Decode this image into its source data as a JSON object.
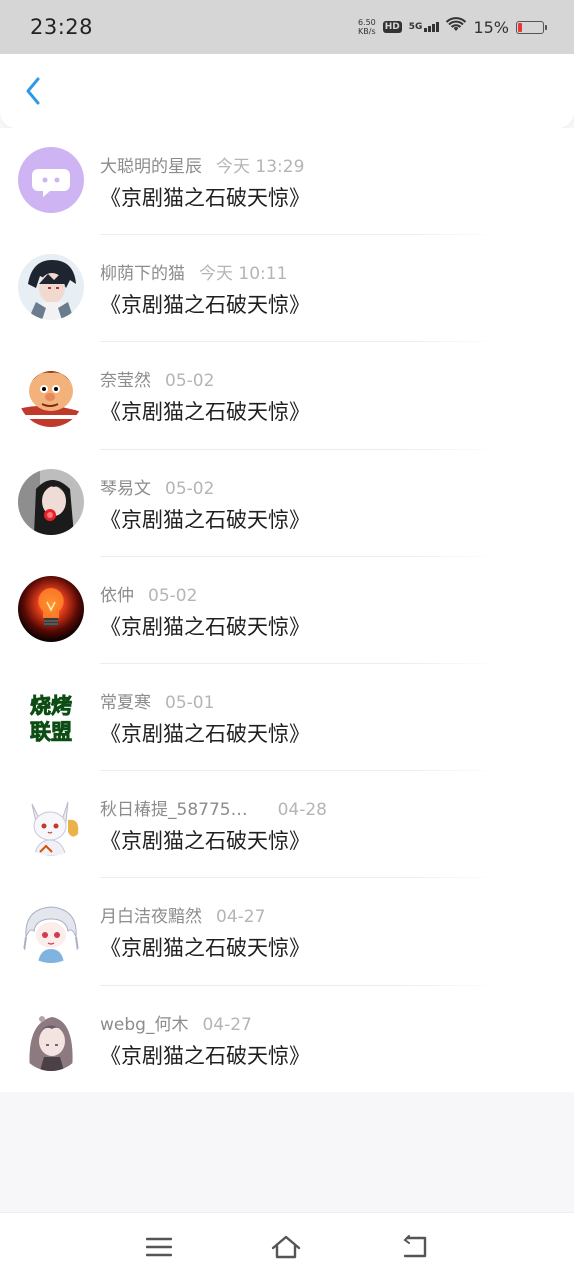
{
  "status_bar": {
    "time": "23:28",
    "net_speed_value": "6.50",
    "net_speed_unit": "KB/s",
    "hd": "HD",
    "network": "5G",
    "battery_pct": "15%",
    "battery_level": 0.15,
    "battery_color": "#e53935"
  },
  "header": {
    "back_icon": "chevron-left-icon",
    "accent": "#2f9be6"
  },
  "comments": [
    {
      "user": "大聪明的星辰",
      "time": "今天 13:29",
      "content": "《京剧猫之石破天惊》",
      "avatar": "chat-bubble-avatar"
    },
    {
      "user": "柳荫下的猫",
      "time": "今天 10:11",
      "content": "《京剧猫之石破天惊》",
      "avatar": "anime-boy-avatar"
    },
    {
      "user": "奈莹然",
      "time": "05-02",
      "content": "《京剧猫之石破天惊》",
      "avatar": "cartoon-face-avatar"
    },
    {
      "user": "琴易文",
      "time": "05-02",
      "content": "《京剧猫之石破天惊》",
      "avatar": "girl-photo-avatar"
    },
    {
      "user": "依仲",
      "time": "05-02",
      "content": "《京剧猫之石破天惊》",
      "avatar": "lightbulb-avatar"
    },
    {
      "user": "常夏寒",
      "time": "05-01",
      "content": "《京剧猫之石破天惊》",
      "avatar": "green-text-avatar",
      "avatar_text_1": "烧烤",
      "avatar_text_2": "联盟"
    },
    {
      "user": "秋日椿提_58775…",
      "time": "04-28",
      "content": "《京剧猫之石破天惊》",
      "avatar": "white-fox-avatar"
    },
    {
      "user": "月白洁夜黯然",
      "time": "04-27",
      "content": "《京剧猫之石破天惊》",
      "avatar": "chibi-girl-avatar"
    },
    {
      "user": "webg_何木",
      "time": "04-27",
      "content": "《京剧猫之石破天惊》",
      "avatar": "anime-girl-avatar"
    }
  ],
  "bottom_nav": {
    "items": [
      "menu-icon",
      "home-icon",
      "back-icon"
    ]
  }
}
